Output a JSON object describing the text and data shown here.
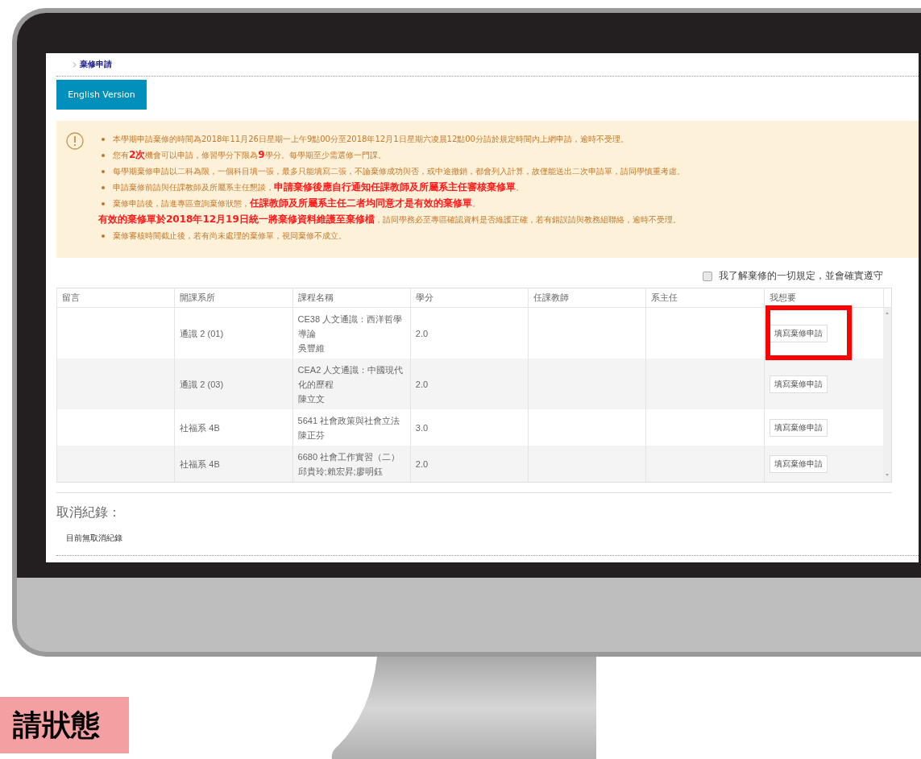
{
  "breadcrumb": {
    "label": "棄修申請"
  },
  "english_button": {
    "label": "English Version"
  },
  "notice": {
    "items": [
      {
        "kind": "bullet",
        "text": "本學期申請棄修的時間為2018年11月26日星期一上午9點00分至2018年12月1日星期六凌晨12點00分請於規定時間內上網申請，逾時不受理。"
      },
      {
        "kind": "bullet",
        "text": "您有**2次**機會可以申請，修習學分下限為**9**學分。每學期至少需選修一門課。"
      },
      {
        "kind": "bullet",
        "text": "每學期棄修申請以二科為限，一個科目填一張，最多只能填寫二張，不論棄修成功與否，或中途撤銷，都會列入計算，故僅能送出二次申請單，請同學慎重考慮。"
      },
      {
        "kind": "bullet",
        "text": "申請棄修前請與任課教師及所屬系主任懇談，**申請棄修後應自行通知任課教師及所屬系主任審核棄修單**。"
      },
      {
        "kind": "bullet",
        "text": "棄修申請後，請進專區查詢棄修狀態，**任課教師及所屬系主任二者均同意才是有效的棄修單**。"
      },
      {
        "kind": "plain",
        "text": "**有效的棄修單於2018年12月19日統一將棄修資料維護至棄修檔**，請同學務必至專區確認資料是否維護正確，若有錯誤請與教務組聯絡，逾時不受理。"
      },
      {
        "kind": "bullet",
        "text": "棄修審核時間截止後，若有尚未處理的棄修單，視同棄修不成立。"
      }
    ]
  },
  "agreement": {
    "label": "我了解棄修的一切規定，並會確實遵守",
    "checked": false
  },
  "table": {
    "columns": [
      "留言",
      "開課系所",
      "課程名稱",
      "學分",
      "任課教師",
      "系主任",
      "我想要"
    ],
    "rows": [
      {
        "department": "通識 2 (01)",
        "course": "CE38 人文通識：西洋哲學導論",
        "instructor": "吳豐維",
        "credits": "2.0",
        "action": "填寫棄修申請",
        "highlighted": true
      },
      {
        "department": "通識 2 (03)",
        "course": "CEA2 人文通識：中國現代化的歷程",
        "instructor": "陳立文",
        "credits": "2.0",
        "action": "填寫棄修申請",
        "highlighted": false
      },
      {
        "department": "社福系 4B",
        "course": "5641 社會政策與社會立法",
        "instructor": "陳正芬",
        "credits": "3.0",
        "action": "填寫棄修申請",
        "highlighted": false
      },
      {
        "department": "社福系 4B",
        "course": "6680 社會工作實習（二）",
        "instructor": "邱貴玲;賴宏昇;廖明鈺",
        "credits": "2.0",
        "action": "填寫棄修申請",
        "highlighted": false
      }
    ]
  },
  "cancel_records": {
    "title": "取消紀錄：",
    "message": "目前無取消紀錄"
  },
  "caption": {
    "label": "請狀態"
  }
}
